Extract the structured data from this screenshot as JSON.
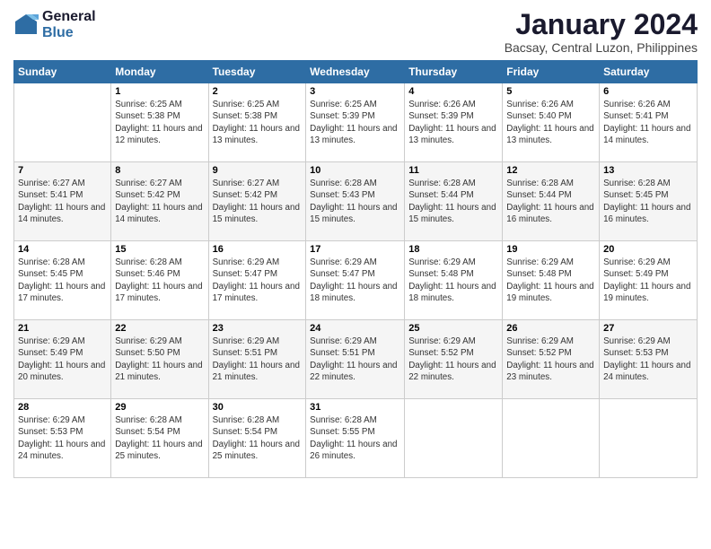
{
  "logo": {
    "line1": "General",
    "line2": "Blue"
  },
  "title": "January 2024",
  "subtitle": "Bacsay, Central Luzon, Philippines",
  "days_header": [
    "Sunday",
    "Monday",
    "Tuesday",
    "Wednesday",
    "Thursday",
    "Friday",
    "Saturday"
  ],
  "weeks": [
    [
      {
        "num": "",
        "sunrise": "",
        "sunset": "",
        "daylight": ""
      },
      {
        "num": "1",
        "sunrise": "Sunrise: 6:25 AM",
        "sunset": "Sunset: 5:38 PM",
        "daylight": "Daylight: 11 hours and 12 minutes."
      },
      {
        "num": "2",
        "sunrise": "Sunrise: 6:25 AM",
        "sunset": "Sunset: 5:38 PM",
        "daylight": "Daylight: 11 hours and 13 minutes."
      },
      {
        "num": "3",
        "sunrise": "Sunrise: 6:25 AM",
        "sunset": "Sunset: 5:39 PM",
        "daylight": "Daylight: 11 hours and 13 minutes."
      },
      {
        "num": "4",
        "sunrise": "Sunrise: 6:26 AM",
        "sunset": "Sunset: 5:39 PM",
        "daylight": "Daylight: 11 hours and 13 minutes."
      },
      {
        "num": "5",
        "sunrise": "Sunrise: 6:26 AM",
        "sunset": "Sunset: 5:40 PM",
        "daylight": "Daylight: 11 hours and 13 minutes."
      },
      {
        "num": "6",
        "sunrise": "Sunrise: 6:26 AM",
        "sunset": "Sunset: 5:41 PM",
        "daylight": "Daylight: 11 hours and 14 minutes."
      }
    ],
    [
      {
        "num": "7",
        "sunrise": "Sunrise: 6:27 AM",
        "sunset": "Sunset: 5:41 PM",
        "daylight": "Daylight: 11 hours and 14 minutes."
      },
      {
        "num": "8",
        "sunrise": "Sunrise: 6:27 AM",
        "sunset": "Sunset: 5:42 PM",
        "daylight": "Daylight: 11 hours and 14 minutes."
      },
      {
        "num": "9",
        "sunrise": "Sunrise: 6:27 AM",
        "sunset": "Sunset: 5:42 PM",
        "daylight": "Daylight: 11 hours and 15 minutes."
      },
      {
        "num": "10",
        "sunrise": "Sunrise: 6:28 AM",
        "sunset": "Sunset: 5:43 PM",
        "daylight": "Daylight: 11 hours and 15 minutes."
      },
      {
        "num": "11",
        "sunrise": "Sunrise: 6:28 AM",
        "sunset": "Sunset: 5:44 PM",
        "daylight": "Daylight: 11 hours and 15 minutes."
      },
      {
        "num": "12",
        "sunrise": "Sunrise: 6:28 AM",
        "sunset": "Sunset: 5:44 PM",
        "daylight": "Daylight: 11 hours and 16 minutes."
      },
      {
        "num": "13",
        "sunrise": "Sunrise: 6:28 AM",
        "sunset": "Sunset: 5:45 PM",
        "daylight": "Daylight: 11 hours and 16 minutes."
      }
    ],
    [
      {
        "num": "14",
        "sunrise": "Sunrise: 6:28 AM",
        "sunset": "Sunset: 5:45 PM",
        "daylight": "Daylight: 11 hours and 17 minutes."
      },
      {
        "num": "15",
        "sunrise": "Sunrise: 6:28 AM",
        "sunset": "Sunset: 5:46 PM",
        "daylight": "Daylight: 11 hours and 17 minutes."
      },
      {
        "num": "16",
        "sunrise": "Sunrise: 6:29 AM",
        "sunset": "Sunset: 5:47 PM",
        "daylight": "Daylight: 11 hours and 17 minutes."
      },
      {
        "num": "17",
        "sunrise": "Sunrise: 6:29 AM",
        "sunset": "Sunset: 5:47 PM",
        "daylight": "Daylight: 11 hours and 18 minutes."
      },
      {
        "num": "18",
        "sunrise": "Sunrise: 6:29 AM",
        "sunset": "Sunset: 5:48 PM",
        "daylight": "Daylight: 11 hours and 18 minutes."
      },
      {
        "num": "19",
        "sunrise": "Sunrise: 6:29 AM",
        "sunset": "Sunset: 5:48 PM",
        "daylight": "Daylight: 11 hours and 19 minutes."
      },
      {
        "num": "20",
        "sunrise": "Sunrise: 6:29 AM",
        "sunset": "Sunset: 5:49 PM",
        "daylight": "Daylight: 11 hours and 19 minutes."
      }
    ],
    [
      {
        "num": "21",
        "sunrise": "Sunrise: 6:29 AM",
        "sunset": "Sunset: 5:49 PM",
        "daylight": "Daylight: 11 hours and 20 minutes."
      },
      {
        "num": "22",
        "sunrise": "Sunrise: 6:29 AM",
        "sunset": "Sunset: 5:50 PM",
        "daylight": "Daylight: 11 hours and 21 minutes."
      },
      {
        "num": "23",
        "sunrise": "Sunrise: 6:29 AM",
        "sunset": "Sunset: 5:51 PM",
        "daylight": "Daylight: 11 hours and 21 minutes."
      },
      {
        "num": "24",
        "sunrise": "Sunrise: 6:29 AM",
        "sunset": "Sunset: 5:51 PM",
        "daylight": "Daylight: 11 hours and 22 minutes."
      },
      {
        "num": "25",
        "sunrise": "Sunrise: 6:29 AM",
        "sunset": "Sunset: 5:52 PM",
        "daylight": "Daylight: 11 hours and 22 minutes."
      },
      {
        "num": "26",
        "sunrise": "Sunrise: 6:29 AM",
        "sunset": "Sunset: 5:52 PM",
        "daylight": "Daylight: 11 hours and 23 minutes."
      },
      {
        "num": "27",
        "sunrise": "Sunrise: 6:29 AM",
        "sunset": "Sunset: 5:53 PM",
        "daylight": "Daylight: 11 hours and 24 minutes."
      }
    ],
    [
      {
        "num": "28",
        "sunrise": "Sunrise: 6:29 AM",
        "sunset": "Sunset: 5:53 PM",
        "daylight": "Daylight: 11 hours and 24 minutes."
      },
      {
        "num": "29",
        "sunrise": "Sunrise: 6:28 AM",
        "sunset": "Sunset: 5:54 PM",
        "daylight": "Daylight: 11 hours and 25 minutes."
      },
      {
        "num": "30",
        "sunrise": "Sunrise: 6:28 AM",
        "sunset": "Sunset: 5:54 PM",
        "daylight": "Daylight: 11 hours and 25 minutes."
      },
      {
        "num": "31",
        "sunrise": "Sunrise: 6:28 AM",
        "sunset": "Sunset: 5:55 PM",
        "daylight": "Daylight: 11 hours and 26 minutes."
      },
      {
        "num": "",
        "sunrise": "",
        "sunset": "",
        "daylight": ""
      },
      {
        "num": "",
        "sunrise": "",
        "sunset": "",
        "daylight": ""
      },
      {
        "num": "",
        "sunrise": "",
        "sunset": "",
        "daylight": ""
      }
    ]
  ]
}
